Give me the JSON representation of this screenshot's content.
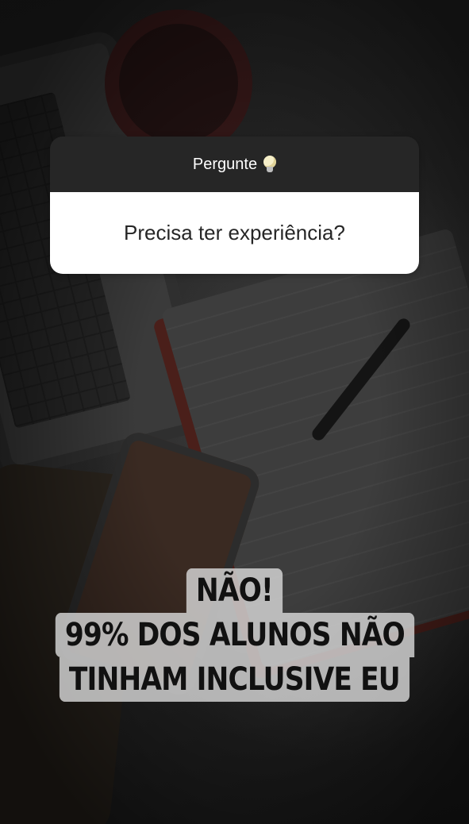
{
  "question_sticker": {
    "header_label": "Pergunte",
    "header_icon": "lightbulb-icon",
    "question_text": "Precisa ter experiência?",
    "header_color": "#262626",
    "body_color": "#ffffff"
  },
  "caption": {
    "lines": [
      "NÃO!",
      "99% DOS ALUNOS NÃO",
      "TINHAM INCLUSIVE EU"
    ],
    "highlight_color": "#d7d7d7"
  }
}
